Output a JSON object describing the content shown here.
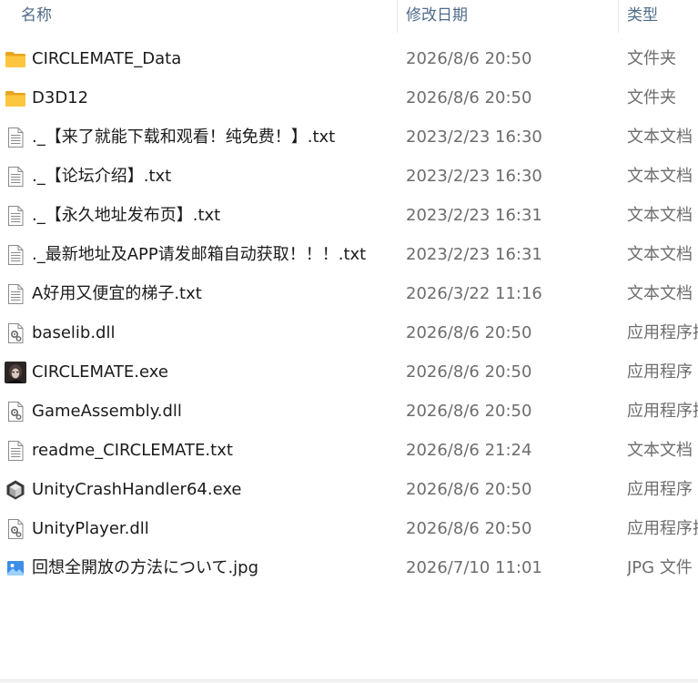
{
  "header": {
    "name_label": "名称",
    "date_label": "修改日期",
    "type_label": "类型",
    "sort_caret": "^"
  },
  "files": [
    {
      "name": "CIRCLEMATE_Data",
      "date": "2026/8/6 20:50",
      "type": "文件夹",
      "icon": "folder-icon"
    },
    {
      "name": "D3D12",
      "date": "2026/8/6 20:50",
      "type": "文件夹",
      "icon": "folder-icon"
    },
    {
      "name": "._【来了就能下载和观看！纯免费！】.txt",
      "date": "2023/2/23 16:30",
      "type": "文本文档",
      "icon": "text-file-icon"
    },
    {
      "name": "._【论坛介绍】.txt",
      "date": "2023/2/23 16:30",
      "type": "文本文档",
      "icon": "text-file-icon"
    },
    {
      "name": "._【永久地址发布页】.txt",
      "date": "2023/2/23 16:31",
      "type": "文本文档",
      "icon": "text-file-icon"
    },
    {
      "name": "._最新地址及APP请发邮箱自动获取！！！.txt",
      "date": "2023/2/23 16:31",
      "type": "文本文档",
      "icon": "text-file-icon"
    },
    {
      "name": "A好用又便宜的梯子.txt",
      "date": "2026/3/22 11:16",
      "type": "文本文档",
      "icon": "text-file-icon"
    },
    {
      "name": "baselib.dll",
      "date": "2026/8/6 20:50",
      "type": "应用程序扩展",
      "icon": "dll-file-icon"
    },
    {
      "name": "CIRCLEMATE.exe",
      "date": "2026/8/6 20:50",
      "type": "应用程序",
      "icon": "game-exe-icon"
    },
    {
      "name": "GameAssembly.dll",
      "date": "2026/8/6 20:50",
      "type": "应用程序扩展",
      "icon": "dll-file-icon"
    },
    {
      "name": "readme_CIRCLEMATE.txt",
      "date": "2026/8/6 21:24",
      "type": "文本文档",
      "icon": "text-file-icon"
    },
    {
      "name": "UnityCrashHandler64.exe",
      "date": "2026/8/6 20:50",
      "type": "应用程序",
      "icon": "unity-exe-icon"
    },
    {
      "name": "UnityPlayer.dll",
      "date": "2026/8/6 20:50",
      "type": "应用程序扩展",
      "icon": "dll-file-icon"
    },
    {
      "name": "回想全開放の方法について.jpg",
      "date": "2026/7/10 11:01",
      "type": "JPG 文件",
      "icon": "image-file-icon"
    }
  ]
}
